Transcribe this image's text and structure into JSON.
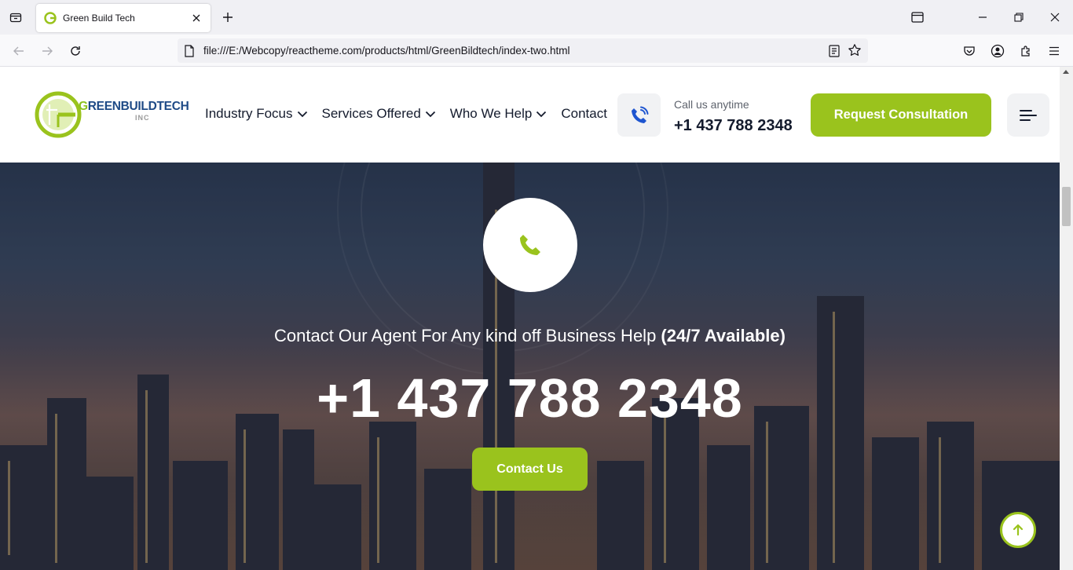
{
  "browser": {
    "tab_title": "Green Build Tech",
    "url": "file:///E:/Webcopy/reactheme.com/products/html/GreenBildtech/index-two.html"
  },
  "header": {
    "logo_text_green": "G",
    "logo_text_main": "REENBUILDTECH",
    "logo_sub": "INC",
    "menu": [
      {
        "label": "Industry Focus",
        "has_dropdown": true
      },
      {
        "label": "Services Offered",
        "has_dropdown": true
      },
      {
        "label": "Who We Help",
        "has_dropdown": true
      },
      {
        "label": "Contact",
        "has_dropdown": false
      }
    ],
    "call_label": "Call us anytime",
    "call_number": "+1 437 788 2348",
    "cta_label": "Request Consultation"
  },
  "hero": {
    "text_regular": "Contact Our Agent For Any kind off Business Help ",
    "text_bold": "(24/7 Available)",
    "phone_number": "+1 437 788 2348",
    "button_label": "Contact Us"
  },
  "colors": {
    "accent": "#9ac31d",
    "brand_blue": "#1e4a86",
    "dark_text": "#141b2d",
    "phone_icon_blue": "#1e55d0"
  }
}
